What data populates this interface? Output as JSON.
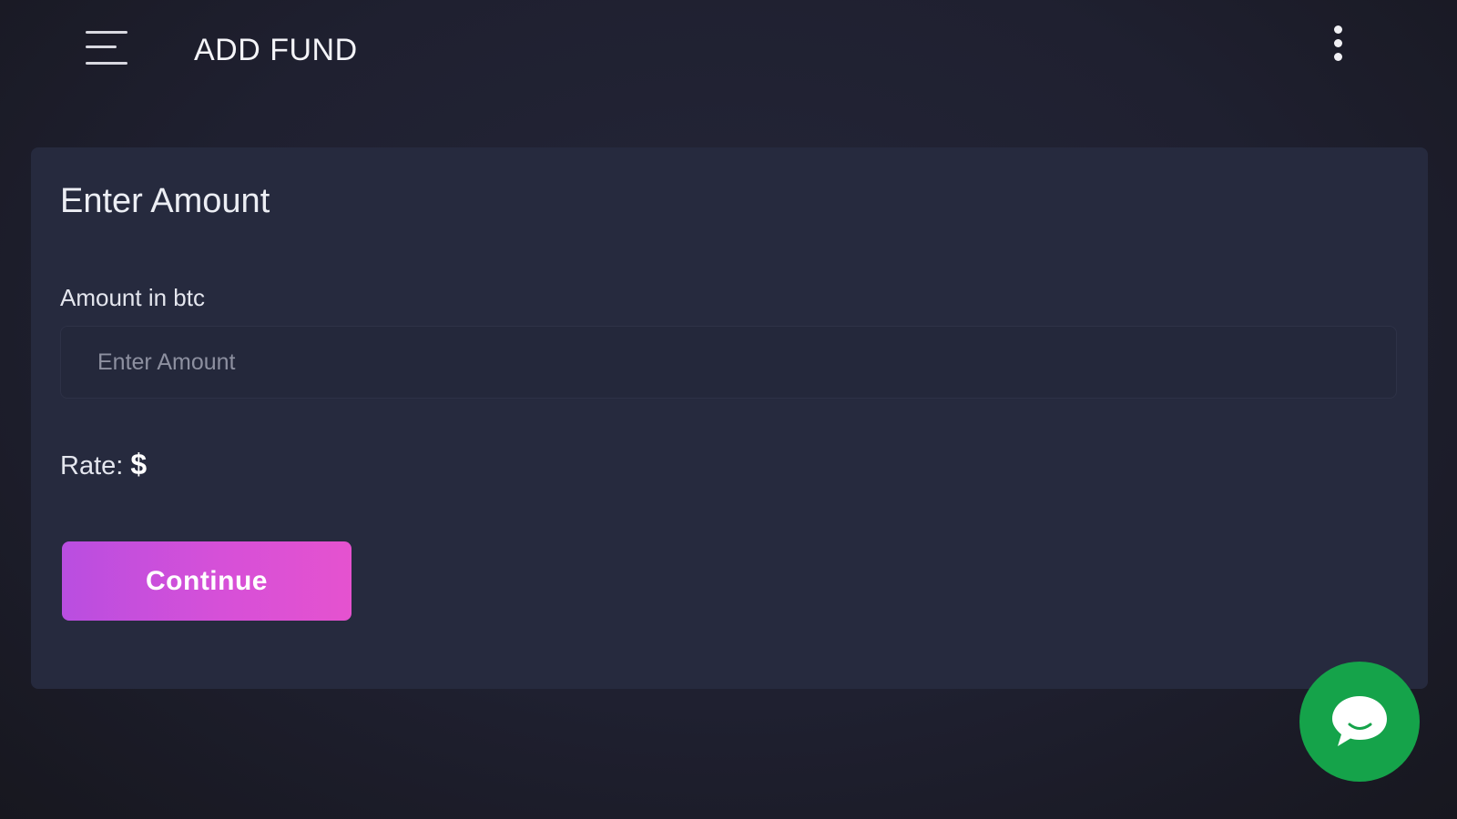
{
  "header": {
    "title": "ADD FUND",
    "menu_icon": "hamburger-menu-icon",
    "more_icon": "vertical-dots-icon"
  },
  "card": {
    "title": "Enter Amount",
    "amount_field": {
      "label": "Amount in btc",
      "placeholder": "Enter Amount",
      "value": ""
    },
    "rate": {
      "label": "Rate:",
      "value": "$"
    },
    "continue_label": "Continue"
  },
  "chat": {
    "icon": "chat-bubble-icon"
  },
  "colors": {
    "background": "#1f2030",
    "card": "#262a3e",
    "accent_gradient_start": "#b94ee0",
    "accent_gradient_end": "#e552cf",
    "chat_button": "#15a34a"
  }
}
